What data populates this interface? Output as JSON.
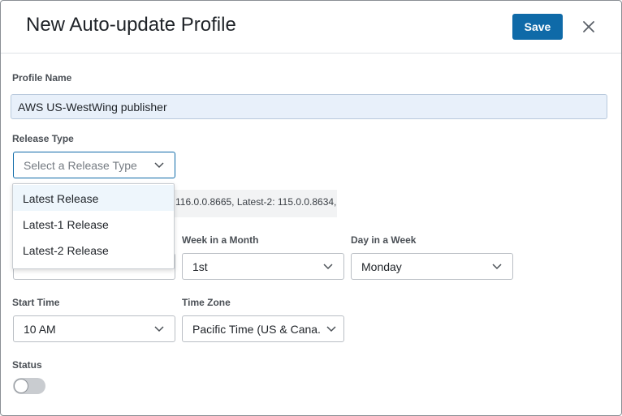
{
  "header": {
    "title": "New Auto-update Profile",
    "save_label": "Save"
  },
  "form": {
    "profile_name": {
      "label": "Profile Name",
      "value": "AWS US-WestWing publisher"
    },
    "release_type": {
      "label": "Release Type",
      "placeholder": "Select a Release Type",
      "options": [
        "Latest Release",
        "Latest-1 Release",
        "Latest-2 Release"
      ],
      "highlighted": "Latest Release"
    },
    "release_info": "116.0.0.8665,  Latest-2: 115.0.0.8634,",
    "week_in_month": {
      "label": "Week in a Month",
      "value": "1st"
    },
    "day_in_week": {
      "label": "Day in a Week",
      "value": "Monday"
    },
    "start_time": {
      "label": "Start Time",
      "value": "10 AM"
    },
    "time_zone": {
      "label": "Time Zone",
      "value": "Pacific Time (US & Cana..."
    },
    "status": {
      "label": "Status",
      "enabled": false
    }
  },
  "colors": {
    "primary": "#0f6aa8",
    "name_field_bg": "#e8f0fa",
    "menu_hover": "#eef6fc"
  }
}
